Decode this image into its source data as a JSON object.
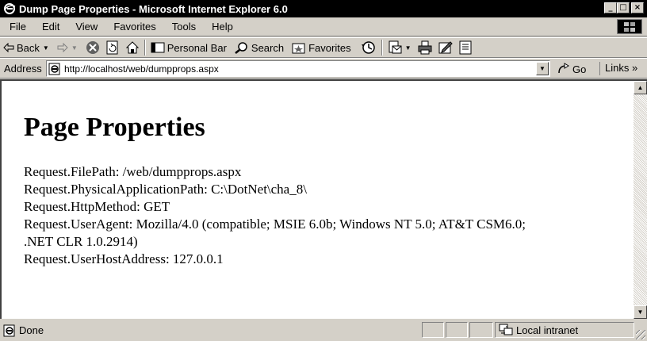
{
  "window": {
    "title": "Dump Page Properties - Microsoft Internet Explorer 6.0",
    "minimize_glyph": "_",
    "maximize_glyph": "□",
    "close_glyph": "×"
  },
  "menu": {
    "items": [
      "File",
      "Edit",
      "View",
      "Favorites",
      "Tools",
      "Help"
    ]
  },
  "toolbar": {
    "back_label": "Back",
    "personal_bar_label": "Personal Bar",
    "search_label": "Search",
    "favorites_label": "Favorites"
  },
  "address": {
    "label": "Address",
    "url": "http://localhost/web/dumpprops.aspx",
    "go_label": "Go",
    "links_label": "Links »"
  },
  "page": {
    "heading": "Page Properties",
    "lines": [
      "Request.FilePath: /web/dumpprops.aspx",
      "Request.PhysicalApplicationPath: C:\\DotNet\\cha_8\\",
      "Request.HttpMethod: GET",
      "Request.UserAgent: Mozilla/4.0 (compatible; MSIE 6.0b; Windows NT 5.0; AT&T CSM6.0;",
      ".NET CLR 1.0.2914)",
      "Request.UserHostAddress: 127.0.0.1"
    ]
  },
  "status": {
    "text": "Done",
    "zone": "Local intranet"
  },
  "colors": {
    "titlebar": "#000000",
    "chrome": "#d4d0c8",
    "content_bg": "#ffffff"
  }
}
